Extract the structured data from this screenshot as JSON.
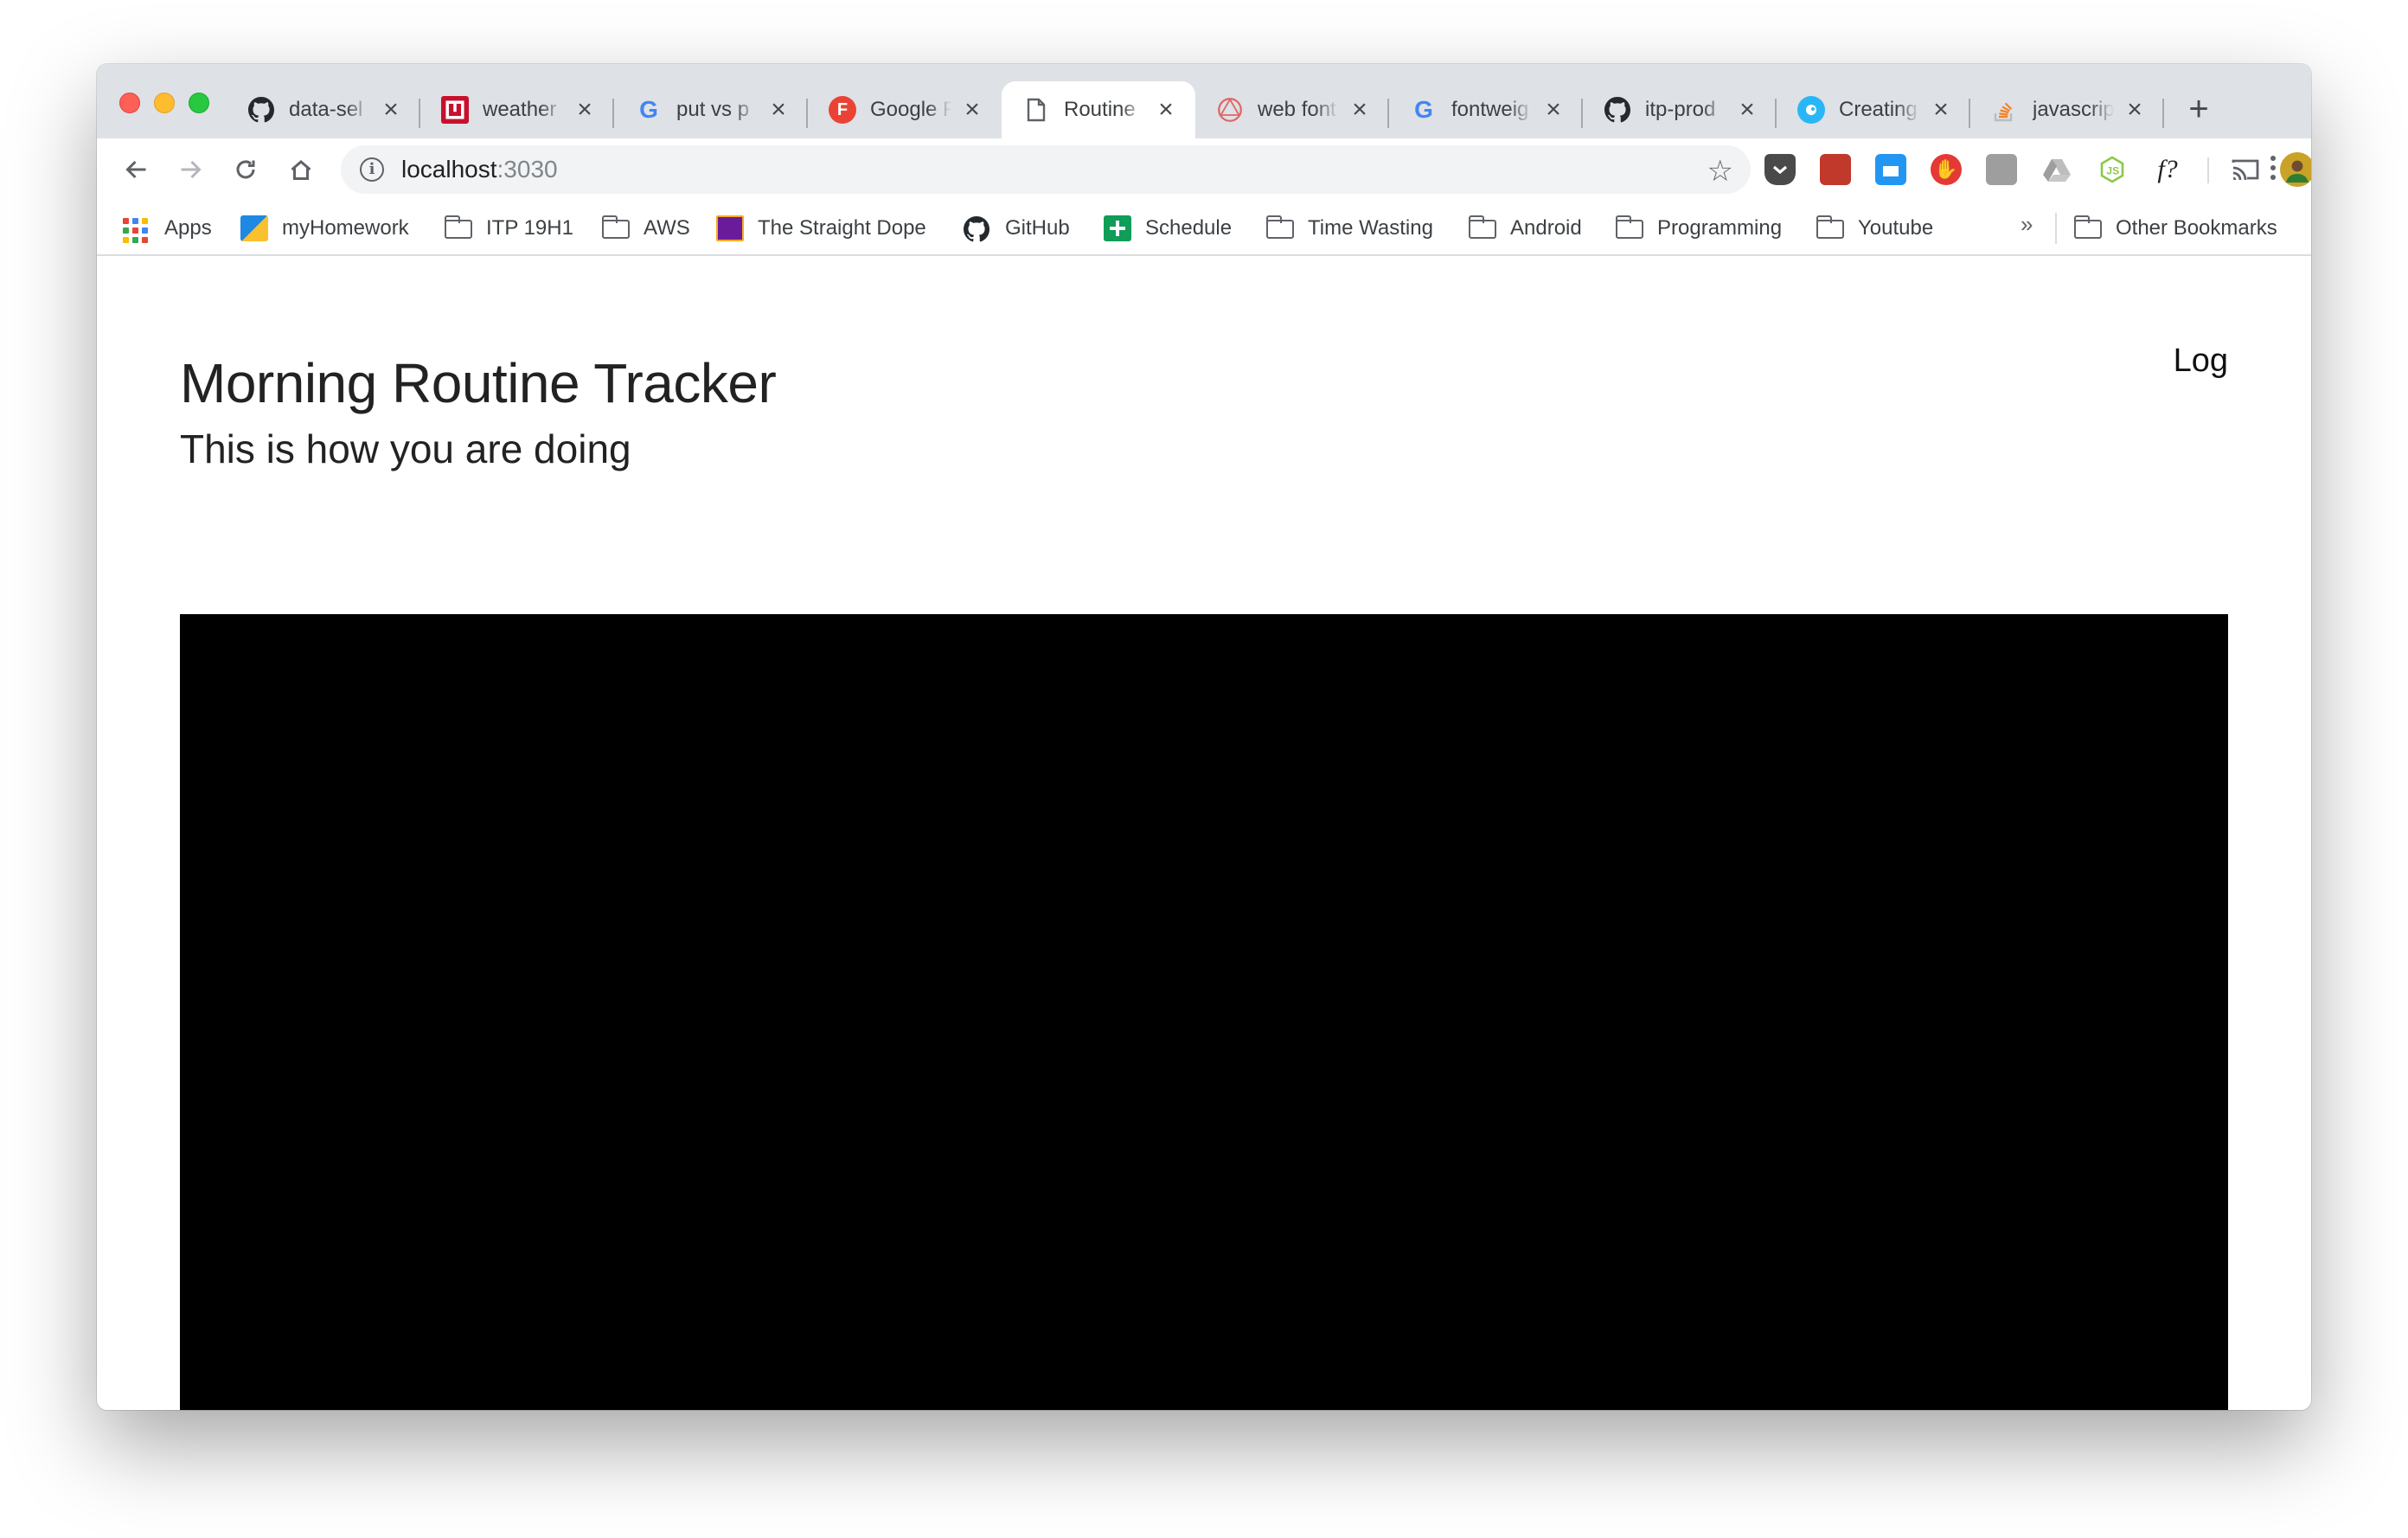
{
  "browser": {
    "tabs": [
      {
        "title": "data-sel",
        "icon": "github-icon"
      },
      {
        "title": "weather",
        "icon": "weather-icon"
      },
      {
        "title": "put vs p",
        "icon": "google-icon"
      },
      {
        "title": "Google F",
        "icon": "google-fonts-icon"
      },
      {
        "title": "Routine",
        "icon": "page-icon",
        "active": true
      },
      {
        "title": "web font",
        "icon": "web-font-icon"
      },
      {
        "title": "fontweig",
        "icon": "google-icon"
      },
      {
        "title": "itp-prod",
        "icon": "github-icon"
      },
      {
        "title": "Creating",
        "icon": "creating-icon"
      },
      {
        "title": "javascrip",
        "icon": "stackoverflow-icon"
      }
    ],
    "url_host": "localhost",
    "url_port": ":3030",
    "bookmarks": [
      {
        "label": "Apps",
        "icon": "apps-grid-icon"
      },
      {
        "label": "myHomework",
        "icon": "myhomework-icon"
      },
      {
        "label": "ITP 19H1",
        "icon": "folder-icon"
      },
      {
        "label": "AWS",
        "icon": "folder-icon"
      },
      {
        "label": "The Straight Dope",
        "icon": "straight-dope-icon"
      },
      {
        "label": "GitHub",
        "icon": "github-icon"
      },
      {
        "label": "Schedule",
        "icon": "sheets-icon"
      },
      {
        "label": "Time Wasting",
        "icon": "folder-icon"
      },
      {
        "label": "Android",
        "icon": "folder-icon"
      },
      {
        "label": "Programming",
        "icon": "folder-icon"
      },
      {
        "label": "Youtube",
        "icon": "folder-icon"
      }
    ],
    "bookmarks_overflow": "»",
    "other_bookmarks": "Other Bookmarks",
    "extension_fx": "f?"
  },
  "page": {
    "title": "Morning Routine Tracker",
    "subtitle": "This is how you are doing",
    "nav_log": "Log"
  },
  "colors": {
    "tabstrip_bg": "#dee1e6",
    "chart_bg": "#000000"
  }
}
